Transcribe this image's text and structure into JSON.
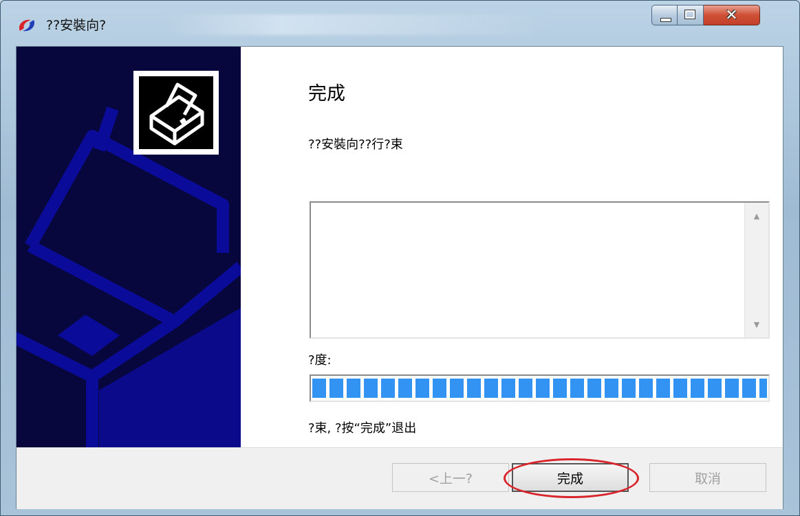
{
  "window": {
    "title": "??安裝向?"
  },
  "content": {
    "heading": "完成",
    "subtext": "??安裝向??行?束",
    "log_text": "",
    "progress_label": "?度:",
    "progress": {
      "value": 1.0
    },
    "status_text": "?束, ?按“完成”退出"
  },
  "buttons": {
    "back_label": "<上一?",
    "finish_label": "完成",
    "cancel_label": "取消"
  },
  "colors": {
    "banner": "#07073d",
    "banner_accent": "#0b0b9a",
    "progress": "#3393f2",
    "annotation": "#d8242a"
  },
  "icons": {
    "app": "app-swirl-icon",
    "banner_logo": "printer-icon"
  }
}
